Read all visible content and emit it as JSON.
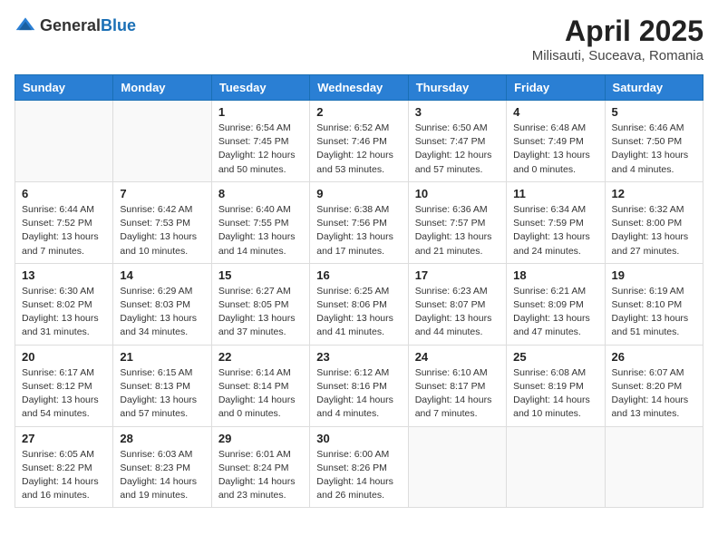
{
  "header": {
    "logo_general": "General",
    "logo_blue": "Blue",
    "month_year": "April 2025",
    "location": "Milisauti, Suceava, Romania"
  },
  "weekdays": [
    "Sunday",
    "Monday",
    "Tuesday",
    "Wednesday",
    "Thursday",
    "Friday",
    "Saturday"
  ],
  "weeks": [
    [
      {
        "day": "",
        "info": ""
      },
      {
        "day": "",
        "info": ""
      },
      {
        "day": "1",
        "info": "Sunrise: 6:54 AM\nSunset: 7:45 PM\nDaylight: 12 hours and 50 minutes."
      },
      {
        "day": "2",
        "info": "Sunrise: 6:52 AM\nSunset: 7:46 PM\nDaylight: 12 hours and 53 minutes."
      },
      {
        "day": "3",
        "info": "Sunrise: 6:50 AM\nSunset: 7:47 PM\nDaylight: 12 hours and 57 minutes."
      },
      {
        "day": "4",
        "info": "Sunrise: 6:48 AM\nSunset: 7:49 PM\nDaylight: 13 hours and 0 minutes."
      },
      {
        "day": "5",
        "info": "Sunrise: 6:46 AM\nSunset: 7:50 PM\nDaylight: 13 hours and 4 minutes."
      }
    ],
    [
      {
        "day": "6",
        "info": "Sunrise: 6:44 AM\nSunset: 7:52 PM\nDaylight: 13 hours and 7 minutes."
      },
      {
        "day": "7",
        "info": "Sunrise: 6:42 AM\nSunset: 7:53 PM\nDaylight: 13 hours and 10 minutes."
      },
      {
        "day": "8",
        "info": "Sunrise: 6:40 AM\nSunset: 7:55 PM\nDaylight: 13 hours and 14 minutes."
      },
      {
        "day": "9",
        "info": "Sunrise: 6:38 AM\nSunset: 7:56 PM\nDaylight: 13 hours and 17 minutes."
      },
      {
        "day": "10",
        "info": "Sunrise: 6:36 AM\nSunset: 7:57 PM\nDaylight: 13 hours and 21 minutes."
      },
      {
        "day": "11",
        "info": "Sunrise: 6:34 AM\nSunset: 7:59 PM\nDaylight: 13 hours and 24 minutes."
      },
      {
        "day": "12",
        "info": "Sunrise: 6:32 AM\nSunset: 8:00 PM\nDaylight: 13 hours and 27 minutes."
      }
    ],
    [
      {
        "day": "13",
        "info": "Sunrise: 6:30 AM\nSunset: 8:02 PM\nDaylight: 13 hours and 31 minutes."
      },
      {
        "day": "14",
        "info": "Sunrise: 6:29 AM\nSunset: 8:03 PM\nDaylight: 13 hours and 34 minutes."
      },
      {
        "day": "15",
        "info": "Sunrise: 6:27 AM\nSunset: 8:05 PM\nDaylight: 13 hours and 37 minutes."
      },
      {
        "day": "16",
        "info": "Sunrise: 6:25 AM\nSunset: 8:06 PM\nDaylight: 13 hours and 41 minutes."
      },
      {
        "day": "17",
        "info": "Sunrise: 6:23 AM\nSunset: 8:07 PM\nDaylight: 13 hours and 44 minutes."
      },
      {
        "day": "18",
        "info": "Sunrise: 6:21 AM\nSunset: 8:09 PM\nDaylight: 13 hours and 47 minutes."
      },
      {
        "day": "19",
        "info": "Sunrise: 6:19 AM\nSunset: 8:10 PM\nDaylight: 13 hours and 51 minutes."
      }
    ],
    [
      {
        "day": "20",
        "info": "Sunrise: 6:17 AM\nSunset: 8:12 PM\nDaylight: 13 hours and 54 minutes."
      },
      {
        "day": "21",
        "info": "Sunrise: 6:15 AM\nSunset: 8:13 PM\nDaylight: 13 hours and 57 minutes."
      },
      {
        "day": "22",
        "info": "Sunrise: 6:14 AM\nSunset: 8:14 PM\nDaylight: 14 hours and 0 minutes."
      },
      {
        "day": "23",
        "info": "Sunrise: 6:12 AM\nSunset: 8:16 PM\nDaylight: 14 hours and 4 minutes."
      },
      {
        "day": "24",
        "info": "Sunrise: 6:10 AM\nSunset: 8:17 PM\nDaylight: 14 hours and 7 minutes."
      },
      {
        "day": "25",
        "info": "Sunrise: 6:08 AM\nSunset: 8:19 PM\nDaylight: 14 hours and 10 minutes."
      },
      {
        "day": "26",
        "info": "Sunrise: 6:07 AM\nSunset: 8:20 PM\nDaylight: 14 hours and 13 minutes."
      }
    ],
    [
      {
        "day": "27",
        "info": "Sunrise: 6:05 AM\nSunset: 8:22 PM\nDaylight: 14 hours and 16 minutes."
      },
      {
        "day": "28",
        "info": "Sunrise: 6:03 AM\nSunset: 8:23 PM\nDaylight: 14 hours and 19 minutes."
      },
      {
        "day": "29",
        "info": "Sunrise: 6:01 AM\nSunset: 8:24 PM\nDaylight: 14 hours and 23 minutes."
      },
      {
        "day": "30",
        "info": "Sunrise: 6:00 AM\nSunset: 8:26 PM\nDaylight: 14 hours and 26 minutes."
      },
      {
        "day": "",
        "info": ""
      },
      {
        "day": "",
        "info": ""
      },
      {
        "day": "",
        "info": ""
      }
    ]
  ]
}
